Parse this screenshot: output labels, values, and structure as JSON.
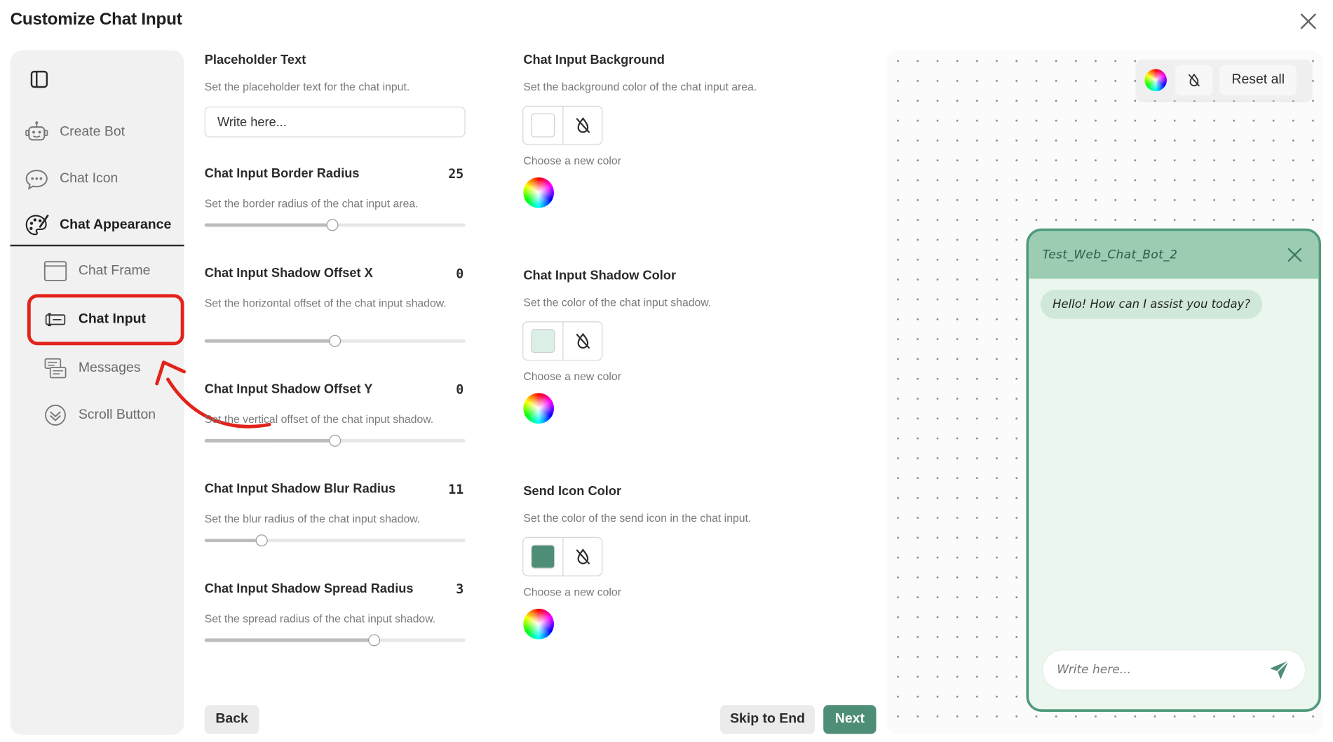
{
  "page": {
    "title": "Customize Chat Input"
  },
  "sidebar": {
    "items": [
      {
        "label": "Create Bot",
        "icon": "bot-icon"
      },
      {
        "label": "Chat Icon",
        "icon": "chat-bubble-icon"
      },
      {
        "label": "Chat Appearance",
        "icon": "palette-icon"
      },
      {
        "label": "Chat Frame",
        "icon": "frame-icon"
      },
      {
        "label": "Chat Input",
        "icon": "chat-input-icon"
      },
      {
        "label": "Messages",
        "icon": "messages-icon"
      },
      {
        "label": "Scroll Button",
        "icon": "scroll-down-icon"
      }
    ]
  },
  "settings": {
    "placeholder": {
      "title": "Placeholder Text",
      "desc": "Set the placeholder text for the chat input.",
      "value": "Write here..."
    },
    "border_radius": {
      "title": "Chat Input Border Radius",
      "desc": "Set the border radius of the chat input area.",
      "value": "25",
      "fraction": 0.49
    },
    "offset_x": {
      "title": "Chat Input Shadow Offset X",
      "desc": "Set the horizontal offset of the chat input shadow.",
      "value": "0",
      "fraction": 0.5
    },
    "offset_y": {
      "title": "Chat Input Shadow Offset Y",
      "desc": "Set the vertical offset of the chat input shadow.",
      "value": "0",
      "fraction": 0.5
    },
    "blur": {
      "title": "Chat Input Shadow Blur Radius",
      "desc": "Set the blur radius of the chat input shadow.",
      "value": "11",
      "fraction": 0.22
    },
    "spread": {
      "title": "Chat Input Shadow Spread Radius",
      "desc": "Set the spread radius of the chat input shadow.",
      "value": "3",
      "fraction": 0.65
    }
  },
  "colors": {
    "choose_label": "Choose a new color",
    "background": {
      "title": "Chat Input Background",
      "desc": "Set the background color of the chat input area.",
      "color": "#ffffff"
    },
    "shadow": {
      "title": "Chat Input Shadow Color",
      "desc": "Set the color of the chat input shadow.",
      "color": "#dcefe6"
    },
    "send_icon": {
      "title": "Send Icon Color",
      "desc": "Set the color of the send icon in the chat input.",
      "color": "#4e8e76"
    }
  },
  "buttons": {
    "back": "Back",
    "skip": "Skip to End",
    "next": "Next"
  },
  "preview": {
    "reset_label": "Reset all",
    "bot_name": "Test_Web_Chat_Bot_2",
    "greeting": "Hello! How can I assist you today?",
    "input_placeholder": "Write here..."
  }
}
